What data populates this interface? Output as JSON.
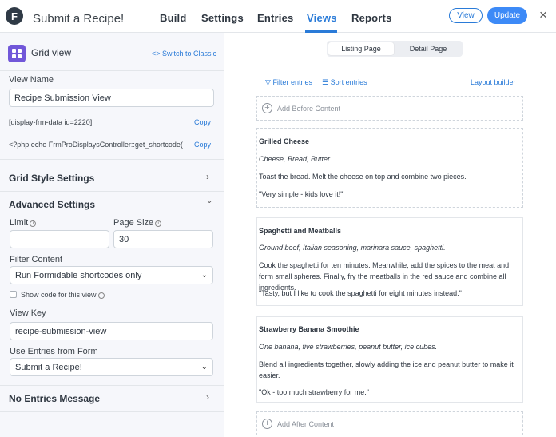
{
  "app": {
    "logo_letter": "F",
    "title": "Submit a Recipe!"
  },
  "nav": {
    "tabs": [
      "Build",
      "Settings",
      "Entries",
      "Views",
      "Reports"
    ],
    "active": "Views"
  },
  "actions": {
    "view_label": "View",
    "update_label": "Update",
    "close_symbol": "×"
  },
  "sidebar": {
    "view_type": "Grid view",
    "switch_label": "Switch to Classic",
    "view_name_label": "View Name",
    "view_name_value": "Recipe Submission View",
    "shortcode": "[display-frm-data id=2220]",
    "php_code": "<?php echo FrmProDisplaysController::get_shortcode(",
    "copy_label": "Copy",
    "grid_style_settings": "Grid Style Settings",
    "advanced_settings": "Advanced Settings",
    "limit_label": "Limit",
    "limit_value": "",
    "page_size_label": "Page Size",
    "page_size_value": "30",
    "filter_content_label": "Filter Content",
    "filter_content_value": "Run Formidable shortcodes only",
    "show_code_label": "Show code for this view",
    "view_key_label": "View Key",
    "view_key_value": "recipe-submission-view",
    "use_entries_label": "Use Entries from Form",
    "use_entries_value": "Submit a Recipe!",
    "no_entries_message": "No Entries Message"
  },
  "main": {
    "toggle": [
      "Listing Page",
      "Detail Page"
    ],
    "toggle_active": "Listing Page",
    "filter_entries": "Filter entries",
    "sort_entries": "Sort entries",
    "layout_builder": "Layout builder",
    "add_before": "Add Before Content",
    "add_after": "Add After Content",
    "entries": [
      {
        "title": "Grilled Cheese",
        "ingredients": "Cheese, Bread, Butter",
        "directions": "Toast the bread. Melt the cheese on top and combine two pieces.",
        "comment": "\"Very simple - kids love it!\""
      },
      {
        "title": "Spaghetti and Meatballs",
        "ingredients": "Ground beef, Italian seasoning, marinara sauce, spaghetti.",
        "directions": "Cook the spaghetti for ten minutes. Meanwhile, add the spices to the meat and form small spheres. Finally, fry the meatballs in the red sauce and combine all ingredients.",
        "comment": "\"Tasty, but I like to cook the spaghetti for eight minutes instead.\""
      },
      {
        "title": "Strawberry Banana Smoothie",
        "ingredients": "One banana, five strawberries, peanut butter, ice cubes.",
        "directions": "Blend all ingredients together, slowly adding the ice and peanut butter to make it easier.",
        "comment": "\"Ok - too much strawberry for me.\""
      }
    ]
  },
  "colors": {
    "accent": "#2a7bd8",
    "update_button": "#3d8af7",
    "view_icon": "#7157d9",
    "sidebar_bg": "#f6f7fb"
  }
}
